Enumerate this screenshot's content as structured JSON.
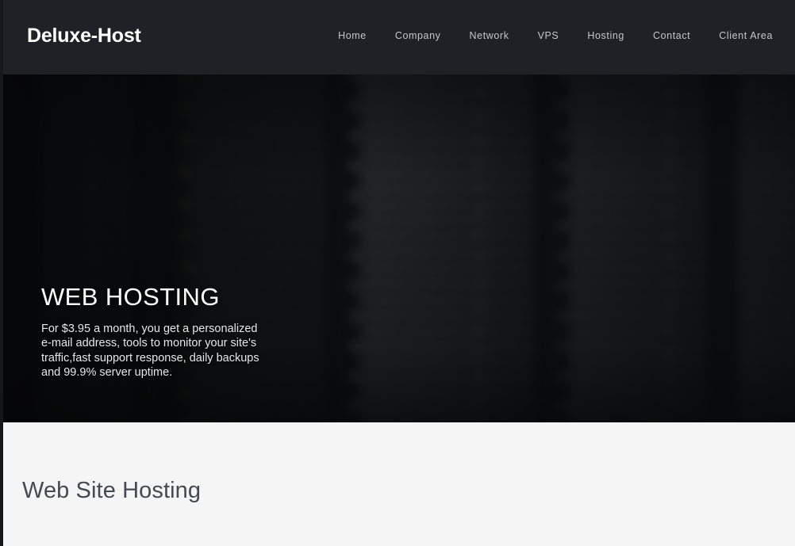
{
  "header": {
    "brand": "Deluxe-Host",
    "nav": [
      {
        "label": "Home"
      },
      {
        "label": "Company"
      },
      {
        "label": "Network"
      },
      {
        "label": "VPS"
      },
      {
        "label": "Hosting"
      },
      {
        "label": "Contact"
      },
      {
        "label": "Client Area"
      }
    ],
    "background_color": "#1e2226",
    "brand_color": "#ffffff",
    "nav_color": "#c3c8cc"
  },
  "hero": {
    "title": "WEB HOSTING",
    "description_lines": [
      "For $3.95 a month, you get a personalized",
      "e-mail address, tools to monitor your site's",
      "traffic,fast support response, daily backups",
      "and 99.9% server uptime."
    ],
    "background_image_description": "blurred dark server rack room photograph",
    "text_color": "#ffffff"
  },
  "content": {
    "section_title": "Web Site Hosting",
    "background_color": "#f5f5f5",
    "title_color": "#434a52"
  }
}
